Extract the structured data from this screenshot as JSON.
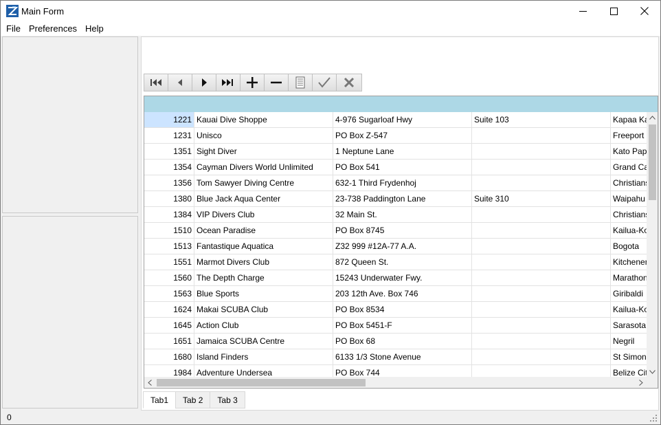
{
  "window": {
    "title": "Main Form"
  },
  "icons": {
    "app": "app-logo-icon",
    "minimize": "minimize-icon",
    "maximize": "maximize-icon",
    "close": "close-icon"
  },
  "menu": {
    "items": [
      "File",
      "Preferences",
      "Help"
    ]
  },
  "navigator": {
    "buttons": [
      "first-record",
      "prior-record",
      "next-record",
      "last-record",
      "insert-record",
      "delete-record",
      "edit-record",
      "post-edit",
      "cancel-edit"
    ]
  },
  "grid": {
    "selected_row": 0,
    "header_color": "#add8e6",
    "rows": [
      [
        "1221",
        "Kauai Dive Shoppe",
        "4-976 Sugarloaf Hwy",
        "Suite 103",
        "Kapaa Ka"
      ],
      [
        "1231",
        "Unisco",
        "PO Box Z-547",
        "",
        "Freeport"
      ],
      [
        "1351",
        "Sight Diver",
        "1 Neptune Lane",
        "",
        "Kato Papl"
      ],
      [
        "1354",
        "Cayman Divers World Unlimited",
        "PO Box 541",
        "",
        "Grand Ca"
      ],
      [
        "1356",
        "Tom Sawyer Diving Centre",
        "632-1 Third Frydenhoj",
        "",
        "Christians"
      ],
      [
        "1380",
        "Blue Jack Aqua Center",
        "23-738 Paddington Lane",
        "Suite 310",
        "Waipahu"
      ],
      [
        "1384",
        "VIP Divers Club",
        "32 Main St.",
        "",
        "Christians"
      ],
      [
        "1510",
        "Ocean Paradise",
        "PO Box 8745",
        "",
        "Kailua-Ko"
      ],
      [
        "1513",
        "Fantastique Aquatica",
        "Z32 999 #12A-77 A.A.",
        "",
        "Bogota"
      ],
      [
        "1551",
        "Marmot Divers Club",
        "872 Queen St.",
        "",
        "Kitchener"
      ],
      [
        "1560",
        "The Depth Charge",
        "15243 Underwater Fwy.",
        "",
        "Marathon"
      ],
      [
        "1563",
        "Blue Sports",
        "203 12th Ave. Box 746",
        "",
        "Giribaldi"
      ],
      [
        "1624",
        "Makai SCUBA Club",
        "PO Box 8534",
        "",
        "Kailua-Ko"
      ],
      [
        "1645",
        "Action Club",
        "PO Box 5451-F",
        "",
        "Sarasota"
      ],
      [
        "1651",
        "Jamaica SCUBA Centre",
        "PO Box 68",
        "",
        "Negril"
      ],
      [
        "1680",
        "Island Finders",
        "6133 1/3 Stone Avenue",
        "",
        "St Simons"
      ],
      [
        "1984",
        "Adventure Undersea",
        "PO Box 744",
        "",
        "Belize Cit"
      ]
    ]
  },
  "tabs": [
    {
      "label": "Tab1",
      "active": true
    },
    {
      "label": "Tab 2",
      "active": false
    },
    {
      "label": "Tab 3",
      "active": false
    }
  ],
  "status": {
    "text": "0"
  }
}
